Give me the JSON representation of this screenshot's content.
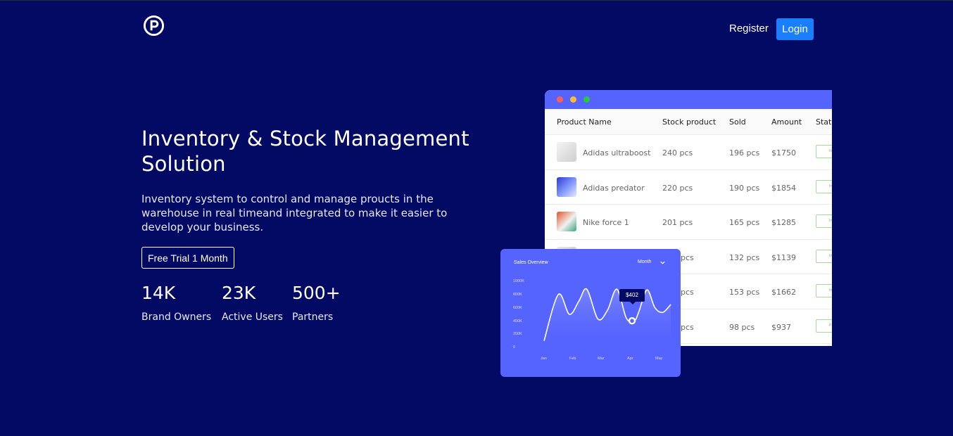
{
  "nav": {
    "logo_icon": "p-circle-logo-icon",
    "register_label": "Register",
    "login_label": "Login",
    "login_color": "#1a7fff"
  },
  "hero": {
    "title": "Inventory & Stock Management Solution",
    "description": "Inventory system to control and manage proucts in the warehouse in real timeand integrated to make it easier to develop your business.",
    "cta_label": "Free Trial 1 Month",
    "stats": [
      {
        "value": "14K",
        "label": "Brand Owners"
      },
      {
        "value": "23K",
        "label": "Active Users"
      },
      {
        "value": "500+",
        "label": "Partners"
      }
    ]
  },
  "table": {
    "window_dots": [
      "#ff5f57",
      "#febc2e",
      "#28c840"
    ],
    "headers": [
      "Product Name",
      "Stock product",
      "Sold",
      "Amount",
      "Status"
    ],
    "rows": [
      {
        "name": "Adidas ultraboost",
        "stock": "240 pcs",
        "sold": "196 pcs",
        "amount": "$1750",
        "status": "In"
      },
      {
        "name": "Adidas predator",
        "stock": "220 pcs",
        "sold": "190 pcs",
        "amount": "$1854",
        "status": "In"
      },
      {
        "name": "Nike force 1",
        "stock": "201 pcs",
        "sold": "165 pcs",
        "amount": "$1285",
        "status": "In"
      },
      {
        "name": "",
        "stock": "pcs",
        "sold": "132 pcs",
        "amount": "$1139",
        "status": "In"
      },
      {
        "name": "",
        "stock": "pcs",
        "sold": "153 pcs",
        "amount": "$1662",
        "status": "In"
      },
      {
        "name": "",
        "stock": "pcs",
        "sold": "98 pcs",
        "amount": "$937",
        "status": "P"
      }
    ]
  },
  "sales": {
    "title": "Sales Overview",
    "period": "Month",
    "tooltip": "$402",
    "chart_data": {
      "type": "line",
      "title": "Sales Overview",
      "x": [
        "Jan",
        "Feb",
        "Mar",
        "Apr",
        "May"
      ],
      "y_ticks": [
        "1000K",
        "800K",
        "600K",
        "400K",
        "200K",
        "0"
      ],
      "ylim": [
        0,
        1000
      ],
      "series": [
        {
          "values_x": [
            0,
            0.45,
            0.8,
            1.1,
            1.35,
            1.7,
            2.0,
            2.3,
            2.6,
            2.85,
            3.0,
            3.25,
            3.5,
            3.75,
            4.0
          ],
          "values_y": [
            100,
            800,
            500,
            700,
            880,
            430,
            560,
            880,
            440,
            402,
            550,
            870,
            600,
            530,
            650
          ]
        }
      ],
      "highlight": {
        "x": "Apr",
        "value": "$402"
      }
    }
  }
}
